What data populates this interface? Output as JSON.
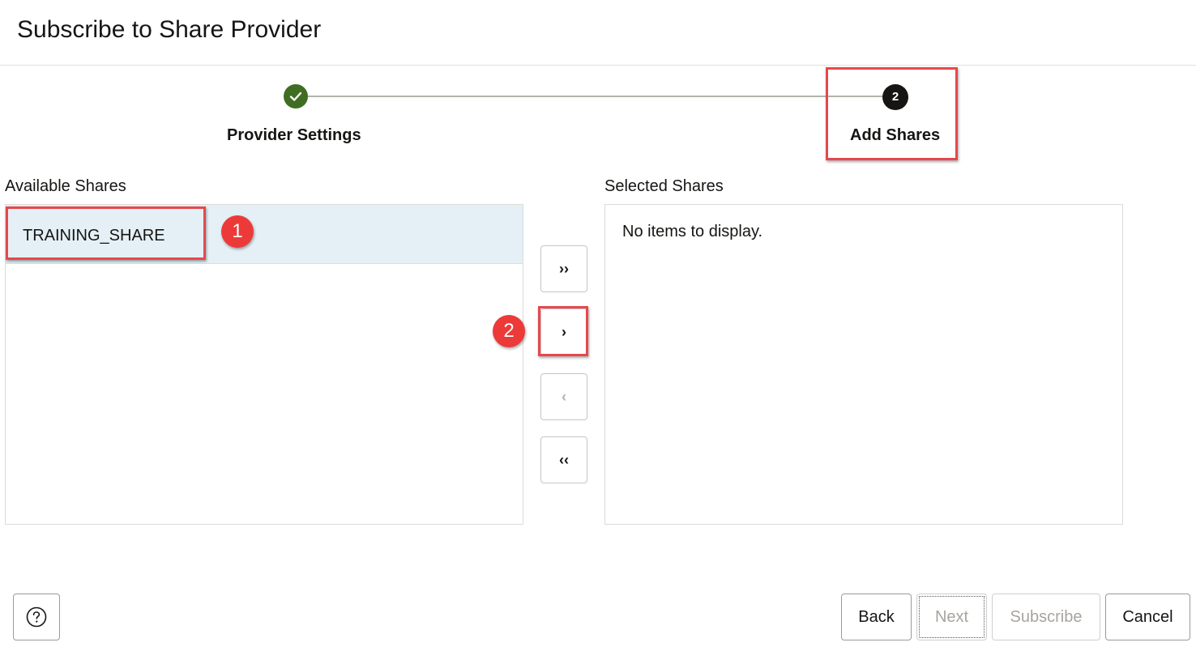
{
  "dialog": {
    "title": "Subscribe to Share Provider"
  },
  "train": {
    "steps": [
      {
        "label": "Provider Settings",
        "state": "completed",
        "icon": "check-icon"
      },
      {
        "label": "Add Shares",
        "number": "2",
        "state": "current"
      }
    ]
  },
  "available": {
    "label": "Available Shares",
    "items": [
      "TRAINING_SHARE"
    ]
  },
  "selected": {
    "label": "Selected Shares",
    "empty_text": "No items to display."
  },
  "shuttle": {
    "move_all": "››",
    "move_one": "›",
    "remove_one": "‹",
    "remove_all": "‹‹"
  },
  "callouts": {
    "badge1": "1",
    "badge2": "2"
  },
  "footer": {
    "help_icon": "question-circle-icon",
    "back": "Back",
    "next": "Next",
    "subscribe": "Subscribe",
    "cancel": "Cancel"
  },
  "colors": {
    "accent_highlight": "#e5484d",
    "completed": "#3f6e22",
    "selection": "#e4f0f5"
  }
}
